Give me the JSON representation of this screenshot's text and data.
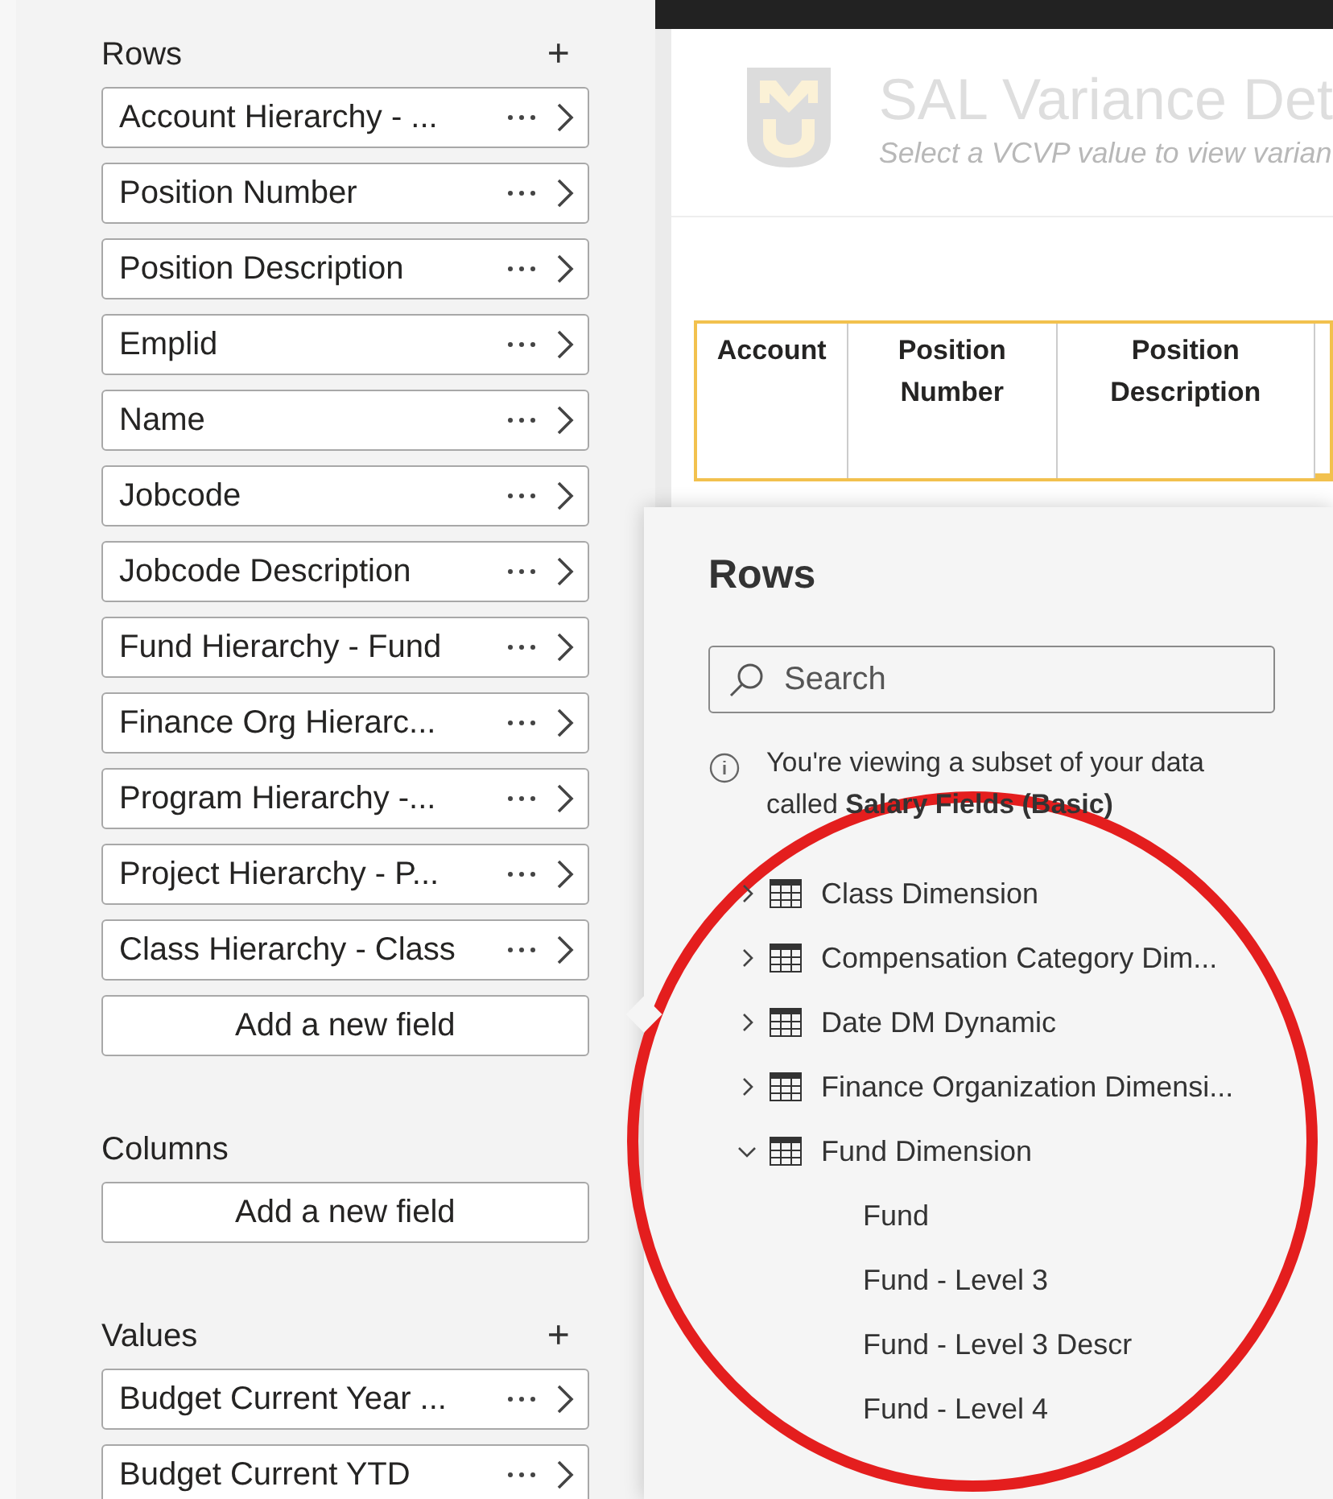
{
  "fields_pane": {
    "sections": [
      {
        "title": "Rows",
        "add": "+",
        "fields": [
          "Account Hierarchy - ...",
          "Position Number",
          "Position Description",
          "Emplid",
          "Name",
          "Jobcode",
          "Jobcode Description",
          "Fund Hierarchy - Fund",
          "Finance Org Hierarc...",
          "Program Hierarchy -...",
          "Project Hierarchy - P...",
          "Class Hierarchy - Class"
        ],
        "add_field": "Add a new field"
      },
      {
        "title": "Columns",
        "add_field": "Add a new field"
      },
      {
        "title": "Values",
        "add": "+",
        "fields": [
          "Budget Current Year ...",
          "Budget Current YTD"
        ]
      }
    ]
  },
  "report": {
    "title": "SAL Variance Det",
    "subtitle": "Select a VCVP value to view varian",
    "table": {
      "columns": [
        "Account",
        "Position Number",
        "Position Description"
      ]
    }
  },
  "popup": {
    "title": "Rows",
    "search": {
      "placeholder": "Search"
    },
    "info": "You're viewing a subset of your data called **Salary Fields (Basic)**",
    "tree": [
      {
        "label": "Class Dimension",
        "expanded": false
      },
      {
        "label": "Compensation Category Dim...",
        "expanded": false
      },
      {
        "label": "Date DM Dynamic",
        "expanded": false
      },
      {
        "label": "Finance Organization Dimensi...",
        "expanded": false
      },
      {
        "label": "Fund Dimension",
        "expanded": true,
        "children": [
          {
            "label": "Fund"
          },
          {
            "label": "Fund - Level 3"
          },
          {
            "label": "Fund - Level 3 Descr"
          },
          {
            "label": "Fund - Level 4"
          }
        ]
      }
    ]
  }
}
